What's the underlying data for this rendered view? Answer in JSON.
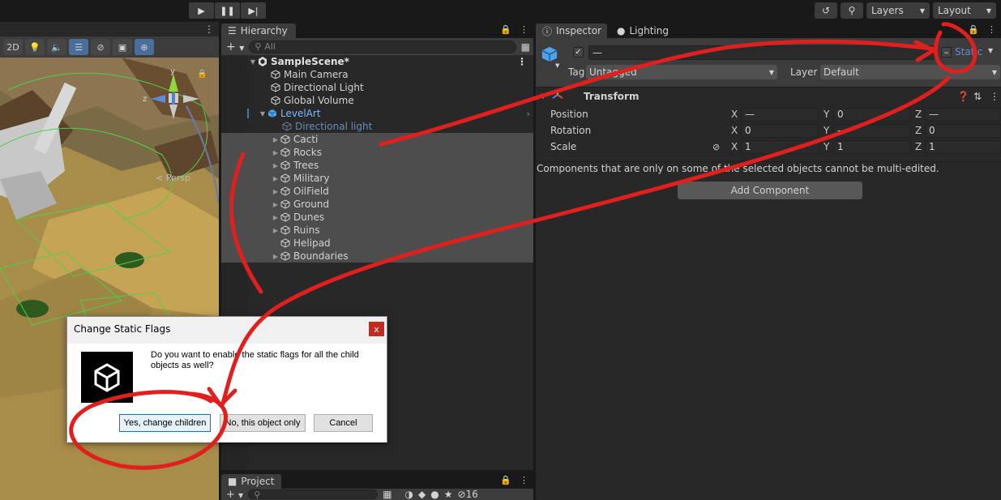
{
  "toolbar": {
    "play_icon": "play-icon",
    "pause_icon": "pause-icon",
    "step_icon": "step-icon",
    "history_icon": "history-icon",
    "search_icon": "search-icon",
    "layers_label": "Layers",
    "layout_label": "Layout"
  },
  "scene": {
    "mode_2d": "2D",
    "persp_label": "< Persp",
    "gizmo_y": "y",
    "gizmo_z": "z"
  },
  "hierarchy": {
    "tab_label": "Hierarchy",
    "search_placeholder": "All",
    "scene_name": "SampleScene*",
    "items": [
      {
        "label": "Main Camera"
      },
      {
        "label": "Directional Light"
      },
      {
        "label": "Global Volume"
      },
      {
        "label": "LevelArt"
      },
      {
        "label": "Directional light"
      },
      {
        "label": "Cacti"
      },
      {
        "label": "Rocks"
      },
      {
        "label": "Trees"
      },
      {
        "label": "Military"
      },
      {
        "label": "OilField"
      },
      {
        "label": "Ground"
      },
      {
        "label": "Dunes"
      },
      {
        "label": "Ruins"
      },
      {
        "label": "Helipad"
      },
      {
        "label": "Boundaries"
      }
    ]
  },
  "project": {
    "tab_label": "Project",
    "hidden_count": "16"
  },
  "inspector": {
    "tab_label": "Inspector",
    "lighting_tab_label": "Lighting",
    "name_value": "—",
    "static_label": "Static",
    "tag_label": "Tag",
    "tag_value": "Untagged",
    "layer_label": "Layer",
    "layer_value": "Default",
    "transform_label": "Transform",
    "position_label": "Position",
    "rotation_label": "Rotation",
    "scale_label": "Scale",
    "axis_x": "X",
    "axis_y": "Y",
    "axis_z": "Z",
    "position": {
      "x": "—",
      "y": "0",
      "z": "—"
    },
    "rotation": {
      "x": "0",
      "y": "—",
      "z": "0"
    },
    "scale": {
      "x": "1",
      "y": "1",
      "z": "1"
    },
    "multi_edit_note": "Components that are only on some of the selected objects cannot be multi-edited.",
    "add_component_label": "Add Component"
  },
  "dialog": {
    "title": "Change Static Flags",
    "close_label": "x",
    "message": "Do you want to enable the static flags for all the child objects as well?",
    "yes_label": "Yes, change children",
    "no_label": "No, this object only",
    "cancel_label": "Cancel"
  },
  "colors": {
    "annotation_red": "#e0201e",
    "selection_blue": "#7bb6ff"
  }
}
